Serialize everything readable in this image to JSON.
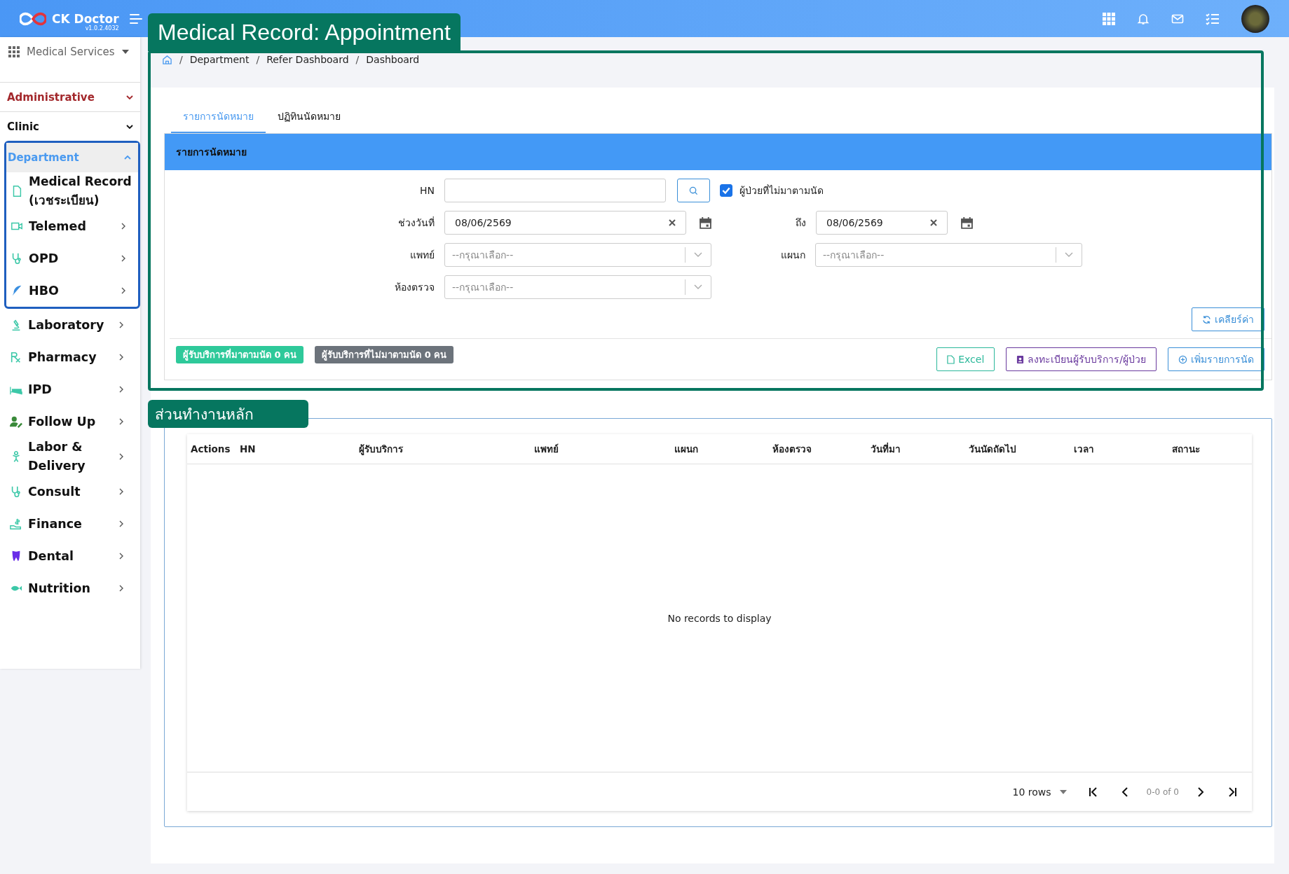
{
  "header": {
    "brand": "CK Doctor",
    "version": "v1.0.2.4032"
  },
  "annotations": [
    {
      "kind": "title",
      "text": "Medical Record: Appointment"
    },
    {
      "kind": "section",
      "text": "ส่วนทำงานหลัก"
    },
    {
      "kind": "sidebar-frame"
    }
  ],
  "sidebar": {
    "module": "Medical Services",
    "groups": [
      {
        "label": "Administrative",
        "color": "#a3282c",
        "expanded": false
      },
      {
        "label": "Clinic",
        "color": "#111111",
        "expanded": false
      },
      {
        "label": "Department",
        "color": "#4a9af0",
        "expanded": true
      }
    ],
    "items": [
      {
        "label": "Medical Record (เวชระเบียน)",
        "expandable": false
      },
      {
        "label": "Telemed",
        "expandable": true
      },
      {
        "label": "OPD",
        "expandable": true
      },
      {
        "label": "HBO",
        "expandable": true
      },
      {
        "label": "Laboratory",
        "expandable": true
      },
      {
        "label": "Pharmacy",
        "expandable": true
      },
      {
        "label": "IPD",
        "expandable": true
      },
      {
        "label": "Follow Up",
        "expandable": true
      },
      {
        "label": "Labor & Delivery",
        "expandable": true
      },
      {
        "label": "Consult",
        "expandable": true
      },
      {
        "label": "Finance",
        "expandable": true
      },
      {
        "label": "Dental",
        "expandable": true
      },
      {
        "label": "Nutrition",
        "expandable": true
      }
    ]
  },
  "breadcrumb": {
    "separator": "/",
    "items": [
      "Department",
      "Refer Dashboard",
      "Dashboard"
    ]
  },
  "tabs": [
    {
      "label": "รายการนัดหมาย",
      "selected": true
    },
    {
      "label": "ปฏิทินนัดหมาย",
      "selected": false
    }
  ],
  "panel": {
    "title": "รายการนัดหมาย",
    "hn": {
      "label": "HN"
    },
    "no_show": {
      "label": "ผู้ป่วยที่ไม่มาตามนัด",
      "checked": true
    },
    "date_from": {
      "label": "ช่วงวันที่",
      "value": "08/06/2569"
    },
    "date_to": {
      "label": "ถึง",
      "value": "08/06/2569"
    },
    "doctor": {
      "label": "แพทย์",
      "placeholder": "--กรุณาเลือก--"
    },
    "department": {
      "label": "แผนก",
      "placeholder": "--กรุณาเลือก--"
    },
    "room": {
      "label": "ห้องตรวจ",
      "placeholder": "--กรุณาเลือก--"
    },
    "clear_button": "เคลียร์ค่า",
    "badges": [
      {
        "text": "ผู้รับบริการที่มาตามนัด 0 คน",
        "color": "#2ec99a"
      },
      {
        "text": "ผู้รับบริการที่ไม่มาตามนัด 0 คน",
        "color": "#6c737b"
      }
    ],
    "buttons": [
      {
        "label": "Excel",
        "color": "#2bb89a"
      },
      {
        "label": "ลงทะเบียนผู้รับบริการ/ผู้ป่วย",
        "color": "#6a3a9e"
      },
      {
        "label": "เพิ่มรายการนัด",
        "color": "#3a8fd8"
      }
    ]
  },
  "table": {
    "columns": [
      "Actions",
      "HN",
      "ผู้รับบริการ",
      "แพทย์",
      "แผนก",
      "ห้องตรวจ",
      "วันที่มา",
      "วันนัดถัดไป",
      "เวลา",
      "สถานะ"
    ],
    "empty_message": "No records to display",
    "pagination": {
      "rows": "10 rows",
      "range": "0-0 of 0"
    }
  }
}
